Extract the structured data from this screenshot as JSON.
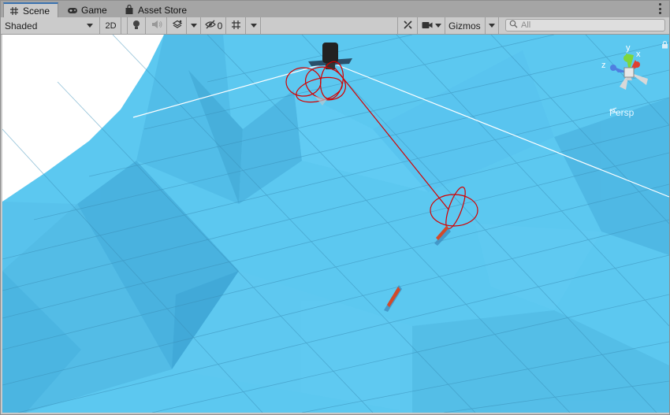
{
  "tabs": [
    {
      "label": "Scene",
      "icon": "grid-hash-icon",
      "active": true
    },
    {
      "label": "Game",
      "icon": "gamepad-icon",
      "active": false
    },
    {
      "label": "Asset Store",
      "icon": "shopping-bag-icon",
      "active": false
    }
  ],
  "toolbar": {
    "draw_mode": "Shaded",
    "mode_2d": "2D",
    "hidden_count": "0",
    "gizmos": "Gizmos",
    "search_placeholder": "All"
  },
  "viewport": {
    "projection_label": "Persp",
    "axis_x": "x",
    "axis_y": "y",
    "axis_z": "z"
  },
  "colors": {
    "sky": "#ffffff",
    "terrain": "#5cc8f0",
    "gizmo_red": "#d40000",
    "tab_accent": "#3a72b0"
  }
}
